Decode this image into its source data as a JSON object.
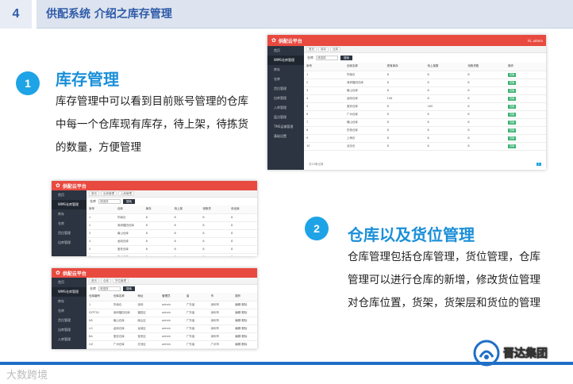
{
  "header": {
    "number": "4",
    "title": "供配系统 介绍之库存管理"
  },
  "section1": {
    "badge": "1",
    "title": "库存管理",
    "body": "库存管理中可以看到目前账号管理的仓库中每一个仓库现有库存，待上架，待拣货的数量，方便管理"
  },
  "section2": {
    "badge": "2",
    "title": "仓库以及货位管理",
    "body": "仓库管理包括仓库管理，货位管理，仓库管理可以进行仓库的新增，修改货位管理对仓库位置，货架，货架层和货位的管理"
  },
  "app": {
    "brand": "供配云平台",
    "user": "Hi, admin",
    "sidebar": [
      "首页",
      "WMS仓库管理",
      "库存",
      "仓库",
      "货位管理",
      "出库管理",
      "入库管理",
      "盘点管理",
      "TMS运输管理",
      "基础设置"
    ],
    "crumbs": [
      "首页",
      "库存",
      "仓库",
      "出库管理",
      "入库管理",
      "货位管理"
    ],
    "filter_label": "仓库",
    "filter_value": "请选择",
    "search": "搜索",
    "inventory_table": {
      "headers": [
        "序号",
        "仓库名称",
        "现有库存",
        "待上架数",
        "待拣货数",
        "操作"
      ],
      "rows": [
        [
          "1",
          "华南仓",
          "8",
          "8",
          "8",
          "查看"
        ],
        [
          "2",
          "深圳福田仓库",
          "8",
          "8",
          "8",
          "查看"
        ],
        [
          "3",
          "南山仓库",
          "8",
          "8",
          "8",
          "查看"
        ],
        [
          "4",
          "龙岗仓库",
          "106",
          "8",
          "8",
          "查看"
        ],
        [
          "5",
          "宝安仓库",
          "8",
          "165",
          "8",
          "查看"
        ],
        [
          "6",
          "广州仓库",
          "8",
          "8",
          "8",
          "查看"
        ],
        [
          "7",
          "佛山仓库",
          "8",
          "8",
          "8",
          "查看"
        ],
        [
          "8",
          "东莞仓库",
          "8",
          "8",
          "8",
          "查看"
        ],
        [
          "9",
          "上海仓",
          "8",
          "8",
          "8",
          "查看"
        ],
        [
          "10",
          "北京仓",
          "8",
          "8",
          "8",
          "查看"
        ]
      ]
    },
    "pager_total": "共10条记录",
    "pager_current": "1",
    "warehouse_table": {
      "headers": [
        "序号",
        "仓库",
        "库存",
        "待上架",
        "待拣货",
        "待出库"
      ],
      "rows": [
        [
          "1",
          "华南仓",
          "8",
          "8",
          "8",
          "8"
        ],
        [
          "2",
          "深圳福田仓库",
          "8",
          "8",
          "8",
          "8"
        ],
        [
          "3",
          "南山仓库",
          "8",
          "8",
          "8",
          "8"
        ],
        [
          "4",
          "龙岗仓库",
          "8",
          "8",
          "8",
          "8"
        ],
        [
          "5",
          "宝安仓库",
          "8",
          "8",
          "8",
          "8"
        ],
        [
          "6",
          "广州仓库",
          "8",
          "8",
          "8",
          "8"
        ]
      ]
    },
    "location_table": {
      "headers": [
        "仓库编号",
        "仓库名称",
        "地址",
        "管理员",
        "省",
        "市",
        "操作"
      ],
      "rows": [
        [
          "1",
          "华南仓",
          "深圳",
          "admin",
          "广东省",
          "深圳市",
          "编辑 删除"
        ],
        [
          "SZFT01",
          "深圳福田仓库",
          "福田区",
          "admin",
          "广东省",
          "深圳市",
          "编辑 删除"
        ],
        [
          "NS",
          "南山仓库",
          "南山区",
          "admin",
          "广东省",
          "深圳市",
          "编辑 删除"
        ],
        [
          "LG",
          "龙岗仓库",
          "龙岗区",
          "admin",
          "广东省",
          "深圳市",
          "编辑 删除"
        ],
        [
          "BA",
          "宝安仓库",
          "宝安区",
          "admin",
          "广东省",
          "深圳市",
          "编辑 删除"
        ],
        [
          "GZ",
          "广州仓库",
          "天河区",
          "admin",
          "广东省",
          "广州市",
          "编辑 删除"
        ],
        [
          "FS",
          "佛山仓库",
          "禅城区",
          "admin",
          "广东省",
          "佛山市",
          "编辑 删除"
        ]
      ]
    }
  },
  "footer": {
    "left": "大数跨境",
    "right": "晋达集团"
  },
  "colors": {
    "accent": "#1ea3e6",
    "title": "#1a8fd8",
    "header_text": "#2f5aa8",
    "app_bar": "#e84a40",
    "sidebar": "#2b3440",
    "footer_line": "#1f6fc6"
  }
}
